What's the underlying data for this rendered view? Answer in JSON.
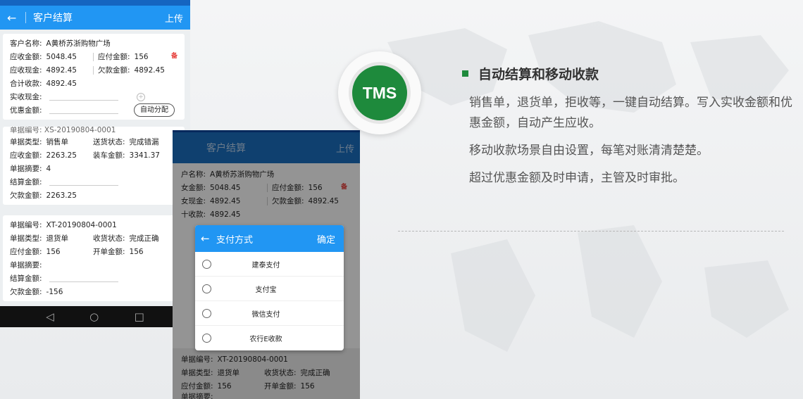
{
  "phone1": {
    "appbar": {
      "back": "←",
      "title": "客户结算",
      "action": "上传"
    },
    "summary": {
      "customer_label": "客户名称:",
      "customer_value": "A黄桥苏浙购物广场",
      "receivable_label": "应收金额:",
      "receivable_value": "5048.45",
      "payable_label": "应付金额:",
      "payable_value": "156",
      "mark": "备",
      "cash_label": "应收现金:",
      "cash_value": "4892.45",
      "debt_label": "欠款金额:",
      "debt_value": "4892.45",
      "total_label": "合计收款:",
      "total_value": "4892.45",
      "actual_label": "实收现金:",
      "discount_label": "优惠金额:",
      "auto_button": "自动分配"
    },
    "card2": {
      "partial_number": "单据编号: XS-20190804-0001",
      "type_label": "单据类型:",
      "type_value": "销售单",
      "delivery_label": "送货状态:",
      "delivery_value": "完成错漏",
      "receivable_label": "应收金额:",
      "receivable_value": "2263.25",
      "load_label": "装车金额:",
      "load_value": "3341.37",
      "memo_label": "单据摘要:",
      "memo_value": "4",
      "settle_label": "结算金额:",
      "debt_label": "欠款金额:",
      "debt_value": "2263.25"
    },
    "card3": {
      "number_label": "单据编号:",
      "number_value": "XT-20190804-0001",
      "type_label": "单据类型:",
      "type_value": "退货单",
      "collect_label": "收货状态:",
      "collect_value": "完成正确",
      "payable_label": "应付金额:",
      "payable_value": "156",
      "open_label": "开单金额:",
      "open_value": "156",
      "memo_label": "单据摘要:",
      "settle_label": "结算金额:",
      "debt_label": "欠款金额:",
      "debt_value": "-156"
    },
    "navbar": {
      "back": "◁",
      "home": "○",
      "recent": "□"
    }
  },
  "phone2": {
    "appbar": {
      "title": "客户结算",
      "action": "上传"
    },
    "summary": {
      "customer_label": "户名称:",
      "customer_value": "A黄桥苏浙购物广场",
      "receivable_label": "女金额:",
      "receivable_value": "5048.45",
      "payable_label": "应付金额:",
      "payable_value": "156",
      "mark": "备",
      "cash_label": "女现金:",
      "cash_value": "4892.45",
      "debt_label": "欠款金额:",
      "debt_value": "4892.45",
      "total_label": "十收款:",
      "total_value": "4892.45"
    },
    "sheet": {
      "back": "←",
      "title": "支付方式",
      "confirm": "确定",
      "options": [
        "建泰支付",
        "支付宝",
        "微信支付",
        "农行E收款"
      ]
    },
    "bottom": {
      "number_label": "单据编号:",
      "number_value": "XT-20190804-0001",
      "type_label": "单据类型:",
      "type_value": "退货单",
      "collect_label": "收货状态:",
      "collect_value": "完成正确",
      "payable_label": "应付金额:",
      "payable_value": "156",
      "open_label": "开单金额:",
      "open_value": "156",
      "memo_label": "单据摘要:"
    }
  },
  "badge": {
    "text": "TMS",
    "color": "#1e8a3c"
  },
  "feature": {
    "title": "自动结算和移动收款",
    "paragraphs": [
      "销售单，退货单，拒收等，一键自动结算。写入实收金额和优惠金额，自动产生应收。",
      "移动收款场景自由设置，每笔对账清清楚楚。",
      "超过优惠金额及时申请，主管及时审批。"
    ]
  },
  "colors": {
    "app_blue": "#2196f3",
    "accent_green": "#1e8a3c",
    "alert_red": "#e53935"
  }
}
